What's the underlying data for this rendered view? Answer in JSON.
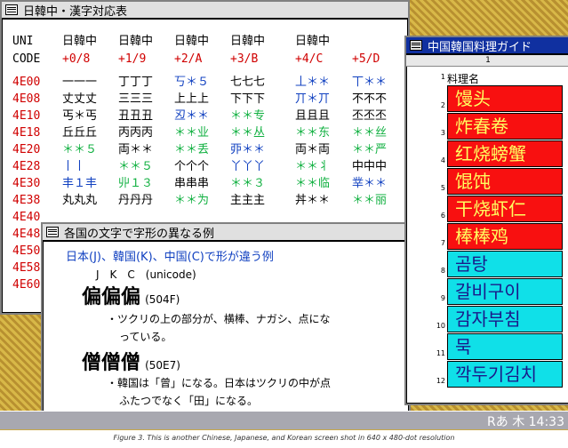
{
  "window1": {
    "title": "日韓中・漢字対応表",
    "col_uni": "UNI",
    "col_code": "CODE",
    "headers": [
      "日韓中",
      "日韓中",
      "日韓中",
      "日韓中",
      "日韓中"
    ],
    "offsets": [
      "+0/8",
      "+1/9",
      "+2/A",
      "+3/B",
      "+4/C",
      "+5/D"
    ],
    "rows": [
      {
        "code": "4E00",
        "c": [
          [
            "一一一",
            "k"
          ],
          [
            "丁丁丁",
            "k"
          ],
          [
            "丂＊５",
            "b"
          ],
          [
            "七七七",
            "k"
          ],
          [
            "丄＊＊",
            "b"
          ],
          [
            "丅＊＊",
            "b"
          ]
        ]
      },
      {
        "code": "4E08",
        "c": [
          [
            "丈丈丈",
            "k"
          ],
          [
            "三三三",
            "k"
          ],
          [
            "上上上",
            "k"
          ],
          [
            "下下下",
            "k"
          ],
          [
            "丌＊丌",
            "b"
          ],
          [
            "不不不",
            "k"
          ]
        ]
      },
      {
        "code": "4E10",
        "c": [
          [
            "丐＊丐",
            "k"
          ],
          [
            "丑丑丑",
            "k"
          ],
          [
            "丒＊＊",
            "b"
          ],
          [
            "＊＊专",
            "g"
          ],
          [
            "且且且",
            "k"
          ],
          [
            "丕丕丕",
            "k"
          ]
        ]
      },
      {
        "code": "4E18",
        "c": [
          [
            "丘丘丘",
            "k"
          ],
          [
            "丙丙丙",
            "k"
          ],
          [
            "＊＊业",
            "g"
          ],
          [
            "＊＊丛",
            "g"
          ],
          [
            "＊＊东",
            "g"
          ],
          [
            "＊＊丝",
            "g"
          ]
        ]
      },
      {
        "code": "4E20",
        "c": [
          [
            "＊＊５",
            "g"
          ],
          [
            "両＊＊",
            "k"
          ],
          [
            "＊＊丢",
            "g"
          ],
          [
            "丣＊＊",
            "b"
          ],
          [
            "両＊両",
            "k"
          ],
          [
            "＊＊严",
            "g"
          ]
        ]
      },
      {
        "code": "4E28",
        "c": [
          [
            "丨丨",
            "b"
          ],
          [
            "＊＊５",
            "g"
          ],
          [
            "个个个",
            "k"
          ],
          [
            "丫丫丫",
            "b"
          ],
          [
            "＊＊丬",
            "g"
          ],
          [
            "中中中",
            "k"
          ]
        ]
      },
      {
        "code": "4E30",
        "c": [
          [
            "丰１丰",
            "b"
          ],
          [
            "丱１３",
            "g"
          ],
          [
            "串串串",
            "k"
          ],
          [
            "＊＊３",
            "g"
          ],
          [
            "＊＊临",
            "g"
          ],
          [
            "丵＊＊",
            "b"
          ]
        ]
      },
      {
        "code": "4E38",
        "c": [
          [
            "丸丸丸",
            "k"
          ],
          [
            "丹丹丹",
            "k"
          ],
          [
            "＊＊为",
            "g"
          ],
          [
            "主主主",
            "k"
          ],
          [
            "丼＊＊",
            "k"
          ],
          [
            "＊＊丽",
            "g"
          ]
        ]
      },
      {
        "code": "4E40",
        "c": []
      },
      {
        "code": "4E48",
        "c": []
      },
      {
        "code": "4E50",
        "c": []
      },
      {
        "code": "4E58",
        "c": []
      },
      {
        "code": "4E60",
        "c": []
      }
    ]
  },
  "window2": {
    "title": "各国の文字で字形の異なる例",
    "line1": "日本(J)、韓国(K)、中国(C)で形が違う例",
    "line2": "J　K　C　(unicode)",
    "ex1_glyphs": "偏偏偏",
    "ex1_code": "(504F)",
    "ex1_note1": "・ツクリの上の部分が、横棒、ナガシ、点にな",
    "ex1_note2": "っている。",
    "ex2_glyphs": "僧僧僧",
    "ex2_code": "(50E7)",
    "ex2_note1": "・韓国は「曾」になる。日本はツクリの中が点",
    "ex2_note2": "ふたつでなく「田」になる。"
  },
  "window3": {
    "title": "中国韓国料理ガイド",
    "col_header": "1",
    "row1_label": "料理名",
    "items": [
      {
        "num": "2",
        "text": "馒头",
        "style": "red"
      },
      {
        "num": "3",
        "text": "炸春卷",
        "style": "red"
      },
      {
        "num": "4",
        "text": "红烧螃蟹",
        "style": "red"
      },
      {
        "num": "5",
        "text": "馄饨",
        "style": "red"
      },
      {
        "num": "6",
        "text": "干烧虾仁",
        "style": "red"
      },
      {
        "num": "7",
        "text": "棒棒鸡",
        "style": "red"
      },
      {
        "num": "8",
        "text": "곰탕",
        "style": "cyan"
      },
      {
        "num": "9",
        "text": "갈비구이",
        "style": "cyan"
      },
      {
        "num": "10",
        "text": "감자부침",
        "style": "cyan"
      },
      {
        "num": "11",
        "text": "묵",
        "style": "cyan"
      },
      {
        "num": "12",
        "text": "깍두기김치",
        "style": "cyan"
      }
    ]
  },
  "taskbar": {
    "ime": "Rあ",
    "day": "木",
    "time": "14:33"
  },
  "caption": "Figure 3. This is another Chinese, Japanese, and Korean screen shot in 640 x 480-dot resolution",
  "colors": {
    "red_cell": "#f81010",
    "cyan_cell": "#10e0e8",
    "code_red": "#d00000",
    "glyph_blue": "#1040c0",
    "glyph_green": "#10b040"
  }
}
